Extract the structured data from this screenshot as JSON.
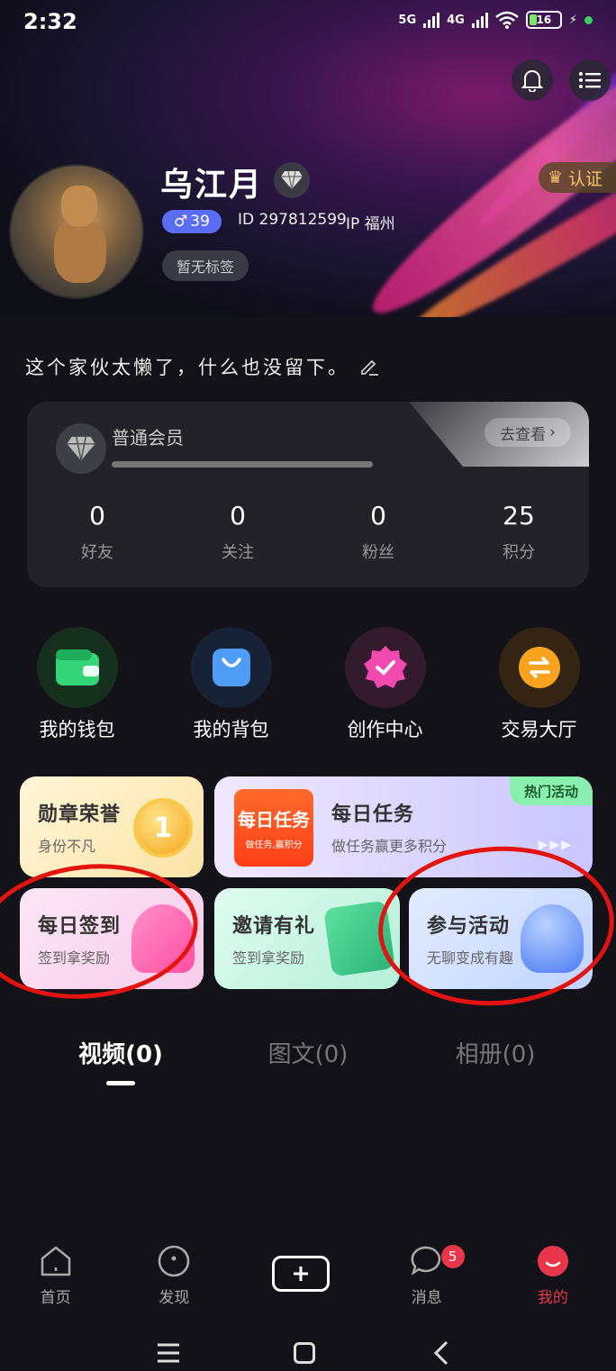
{
  "status_bar": {
    "time": "2:32",
    "network1": "5G",
    "network2": "4G",
    "battery": "16"
  },
  "profile": {
    "name": "乌江月",
    "cert_label": "认证",
    "gender_symbol": "♂",
    "age": "39",
    "id_text": "ID 297812599",
    "ip_text": "IP 福州",
    "tag": "暂无标签",
    "bio": "这个家伙太懒了，什么也没留下。"
  },
  "membership": {
    "level": "普通会员",
    "go_label": "去查看",
    "stats": [
      {
        "value": "0",
        "label": "好友"
      },
      {
        "value": "0",
        "label": "关注"
      },
      {
        "value": "0",
        "label": "粉丝"
      },
      {
        "value": "25",
        "label": "积分"
      }
    ]
  },
  "functions": [
    {
      "label": "我的钱包",
      "icon": "wallet-icon",
      "color": "#2ecc6e",
      "bg": "#16301e"
    },
    {
      "label": "我的背包",
      "icon": "shopping-bag-icon",
      "color": "#4f9cf5",
      "bg": "#182236"
    },
    {
      "label": "创作中心",
      "icon": "badge-check-icon",
      "color": "#f049b0",
      "bg": "#331a2c"
    },
    {
      "label": "交易大厅",
      "icon": "exchange-icon",
      "color": "#f7a31e",
      "bg": "#332414"
    }
  ],
  "cards": {
    "honor": {
      "title": "勋章荣誉",
      "sub": "身份不凡",
      "medal": "1"
    },
    "daily_task": {
      "title": "每日任务",
      "sub": "做任务赢更多积分",
      "logo_big": "每日任务",
      "logo_small": "做任务,赢积分",
      "hot": "热门活动"
    },
    "checkin": {
      "title": "每日签到",
      "sub": "签到拿奖励"
    },
    "invite": {
      "title": "邀请有礼",
      "sub": "签到拿奖励"
    },
    "activity": {
      "title": "参与活动",
      "sub": "无聊变成有趣"
    }
  },
  "tabs": [
    {
      "label": "视频(0)"
    },
    {
      "label": "图文(0)"
    },
    {
      "label": "相册(0)"
    }
  ],
  "nav": [
    {
      "label": "首页"
    },
    {
      "label": "发现"
    },
    {
      "label": ""
    },
    {
      "label": "消息",
      "badge": "5"
    },
    {
      "label": "我的"
    }
  ]
}
